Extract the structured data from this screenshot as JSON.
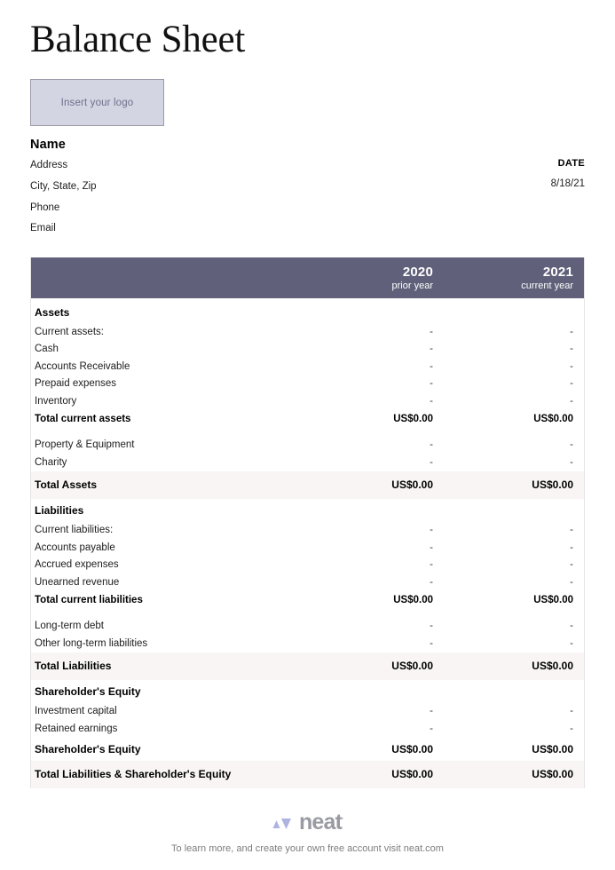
{
  "document": {
    "title": "Balance Sheet"
  },
  "logo": {
    "placeholder": "Insert your logo"
  },
  "contact": {
    "name": "Name",
    "lines": [
      "Address",
      "City, State, Zip",
      "Phone",
      "Email"
    ]
  },
  "date": {
    "label": "DATE",
    "value": "8/18/21"
  },
  "table": {
    "header": {
      "col_a_year": "2020",
      "col_a_sub": "prior year",
      "col_b_year": "2021",
      "col_b_sub": "current year"
    },
    "dash": "-",
    "zero": "US$0.00",
    "sections": {
      "assets": "Assets",
      "liabilities": "Liabilities",
      "equity": "Shareholder's Equity"
    },
    "rows": {
      "current_assets": "Current assets:",
      "cash": "Cash",
      "accounts_receivable": "Accounts Receivable",
      "prepaid_expenses": "Prepaid expenses",
      "inventory": "Inventory",
      "total_current_assets": "Total current assets",
      "property_equipment": "Property & Equipment",
      "charity": "Charity",
      "total_assets": "Total Assets",
      "current_liabilities": "Current liabilities:",
      "accounts_payable": "Accounts payable",
      "accrued_expenses": "Accrued expenses",
      "unearned_revenue": "Unearned revenue",
      "total_current_liabilities": "Total current liabilities",
      "long_term_debt": "Long-term debt",
      "other_long_term": "Other long-term liabilities",
      "total_liabilities": "Total Liabilities",
      "investment_capital": "Investment capital",
      "retained_earnings": "Retained earnings",
      "shareholders_equity_total": "Shareholder's Equity",
      "total_liabilities_equity": "Total Liabilities & Shareholder's Equity"
    }
  },
  "footer": {
    "brand": "neat",
    "trademark": "·",
    "note": "To learn more, and create your own free account visit neat.com"
  },
  "colors": {
    "header_bar": "#60607a",
    "highlight_row": "#f8f5f4",
    "logo_fill": "#d3d5e3",
    "brand_accent": "#aeb4e0"
  }
}
